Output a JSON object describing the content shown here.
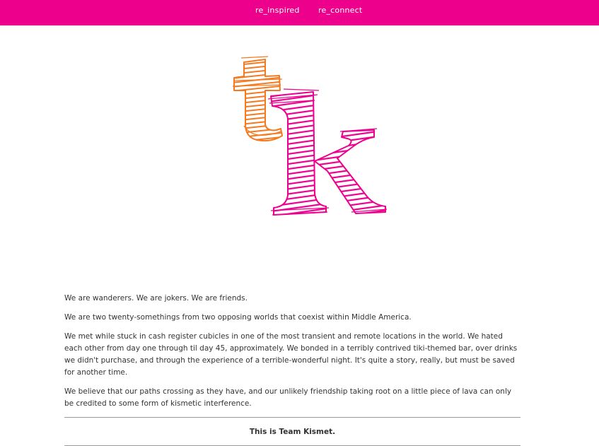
{
  "nav": {
    "items": [
      {
        "label": "re_inspired"
      },
      {
        "label": "re_connect"
      }
    ]
  },
  "logo": {
    "letters": "tk",
    "colors": {
      "t": "#f47a20",
      "k": "#ec008c"
    }
  },
  "intro": {
    "paragraphs": [
      "We are wanderers. We are jokers. We are friends.",
      "We are two twenty-somethings from two opposing worlds that coexist within Middle America.",
      "We met while stuck in cash register cubicles in one of the most transient and remote locations in the world. We hated each other from day one through til day 45, approximately. We bonded in a terribly contrived tiki-themed bar, over drinks we didn't purchase, and through the experience of a terrible-wonderful night. It's quite a story, really, but must be saved for another time.",
      "We believe that our paths crossing as they have, and our unlikely friendship taking root on a little piece of lava can only be credited to some form of kismetic interference."
    ],
    "tagline": "This is Team Kismet."
  },
  "colors": {
    "brand": "#ec008c",
    "accent": "#f47a20",
    "text": "#333333"
  }
}
